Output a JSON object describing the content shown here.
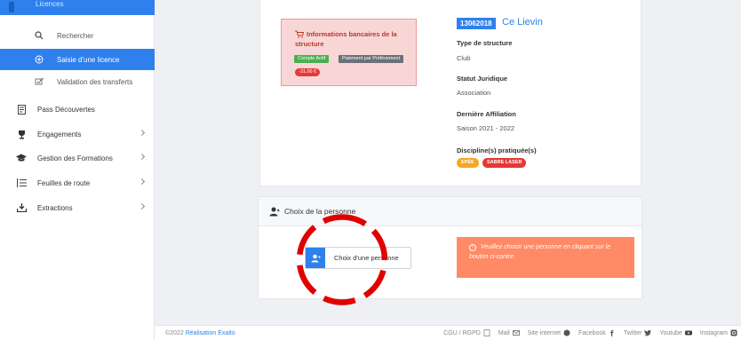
{
  "sidebar": {
    "partial_top_label": "Licences",
    "items": [
      {
        "label": "Rechercher",
        "icon": "search-icon"
      },
      {
        "label": "Saisie d'une licence",
        "icon": "plus-circle-icon"
      },
      {
        "label": "Validation des transferts",
        "icon": "transfer-check-icon"
      },
      {
        "label": "Pass Découvertes",
        "icon": "card-icon"
      },
      {
        "label": "Engagements",
        "icon": "trophy-icon"
      },
      {
        "label": "Gestion des Formations",
        "icon": "graduation-cap-icon"
      },
      {
        "label": "Feuilles de route",
        "icon": "list-icon"
      },
      {
        "label": "Extractions",
        "icon": "download-icon"
      }
    ]
  },
  "bank": {
    "title": "Informations bancaires de la structure",
    "badge_active": "Compte Actif",
    "badge_payment": "Paiement par Prélèvement",
    "amount": "-31,00 €"
  },
  "structure": {
    "id": "13062018",
    "name": "Ce Lievin",
    "type_label": "Type de structure",
    "type_value": "Club",
    "statut_label": "Statut Juridique",
    "statut_value": "Association",
    "affiliation_label": "Dernière Affiliation",
    "affiliation_value": "Saison 2021 - 2022",
    "disciplines_label": "Discipline(s) pratiquée(s)",
    "tags": [
      "EPÉE",
      "SABRE LASER"
    ]
  },
  "person": {
    "header": "Choix de la personne",
    "button": "Choix d'une personne",
    "warning": "Veuillez choisir une personne en cliquant sur le bouton ci-contre."
  },
  "footer": {
    "copyright": "©2022",
    "credit_link": "Réalisation Exalto",
    "links": [
      "CGU / RGPD",
      "Mail",
      "Site internet",
      "Facebook",
      "Twitter",
      "Youtube",
      "Instagram"
    ]
  },
  "colors": {
    "primary": "#2f80ed",
    "danger": "#e53935",
    "warning": "#ff8a65",
    "annotation": "#e00000"
  }
}
